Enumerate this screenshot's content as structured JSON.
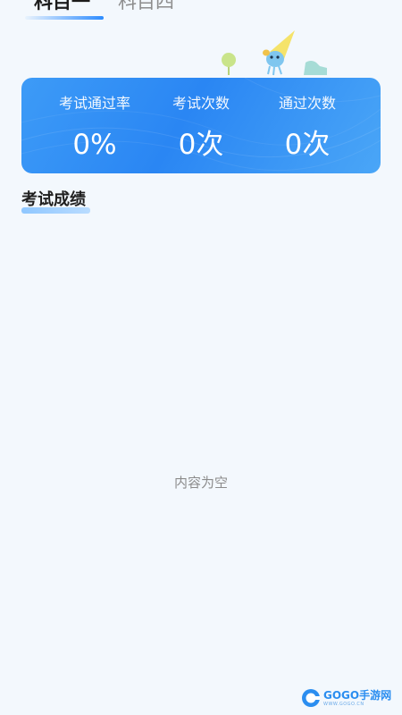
{
  "tabs": [
    {
      "label": "科目一",
      "active": true
    },
    {
      "label": "科目四",
      "active": false
    }
  ],
  "stats": {
    "pass_rate_label": "考试通过率",
    "pass_rate_value": "0%",
    "exam_count_label": "考试次数",
    "exam_count_value": "0次",
    "pass_count_label": "通过次数",
    "pass_count_value": "0次"
  },
  "section": {
    "title": "考试成绩"
  },
  "empty_state": {
    "text": "内容为空"
  },
  "watermark": {
    "text": "GOGO手游网",
    "sub": "WWW.GOGO.CN"
  },
  "colors": {
    "accent": "#2d8cff",
    "card": "#3894f5",
    "background": "#f3f8fd"
  }
}
